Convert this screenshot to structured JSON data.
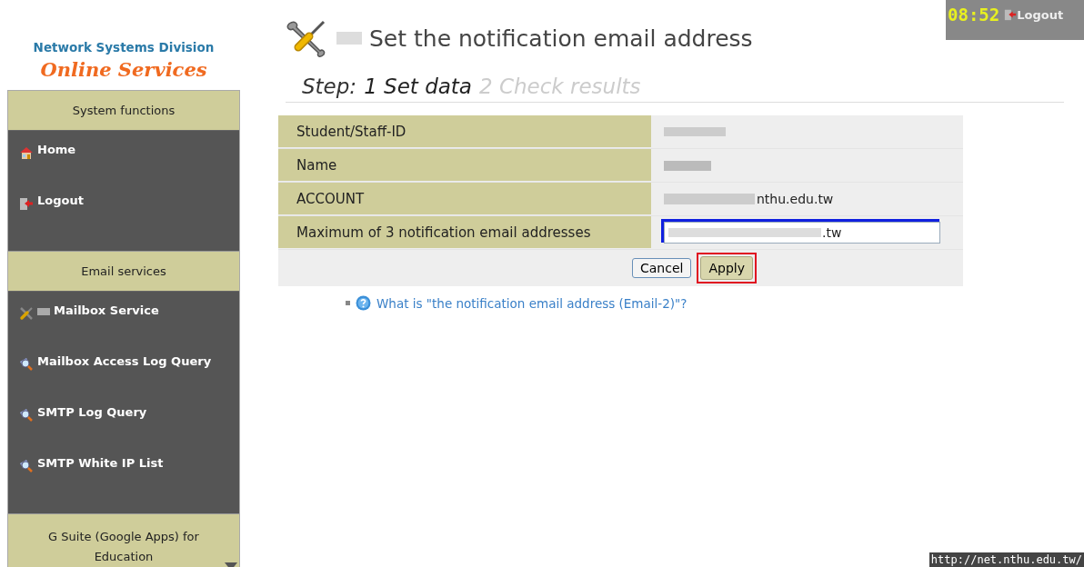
{
  "logo": {
    "division": "Network Systems Division",
    "title": "Online Services"
  },
  "sidebar": {
    "sections": [
      {
        "heading": "System functions",
        "items": [
          {
            "label": "Home",
            "kind": "home"
          },
          {
            "label": "Logout",
            "kind": "logout"
          }
        ]
      },
      {
        "heading": "Email services",
        "items": [
          {
            "label": "Mailbox Service",
            "kind": "tools",
            "redacted_prefix": true
          },
          {
            "label": "Mailbox Access Log Query",
            "kind": "search"
          },
          {
            "label": "SMTP Log Query",
            "kind": "search"
          },
          {
            "label": "SMTP White IP List",
            "kind": "search"
          }
        ]
      },
      {
        "heading": "G Suite (Google Apps) for Education"
      }
    ]
  },
  "page": {
    "title": "Set the notification email address",
    "title_redacted_prefix": true,
    "steps": {
      "prefix": "Step:",
      "items": [
        {
          "label": "1 Set data",
          "selected": true
        },
        {
          "label": "2 Check results",
          "selected": false
        }
      ]
    }
  },
  "form": {
    "rows": [
      {
        "label": "Student/Staff-ID",
        "kind": "text",
        "redacted": true
      },
      {
        "label": "Name",
        "kind": "text",
        "redacted": true
      },
      {
        "label": "ACCOUNT",
        "kind": "text",
        "redacted": true,
        "value": "nthu.edu.tw"
      },
      {
        "label": "Maximum of 3 notification email addresses",
        "kind": "input",
        "redacted": true,
        "value": ".tw",
        "highlighted": true
      }
    ],
    "buttons": [
      {
        "label": "Cancel",
        "kind": "cancel",
        "highlighted": false
      },
      {
        "label": "Apply",
        "kind": "apply",
        "highlighted": true
      }
    ]
  },
  "help_link": "What is \"the notification email address (Email-2)\"?",
  "top_bar": {
    "time": "08:52",
    "logout": "Logout"
  },
  "status_url": "http://net.nthu.edu.tw/"
}
